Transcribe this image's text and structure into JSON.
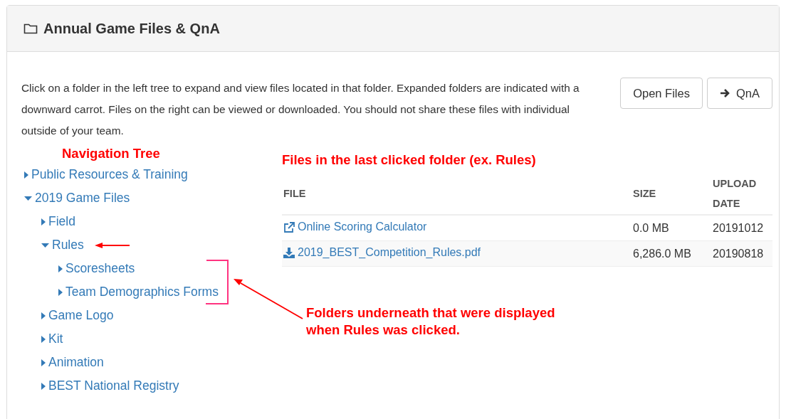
{
  "panel": {
    "title": "Annual Game Files & QnA",
    "intro": "Click on a folder in the left tree to expand and view files located in that folder. Expanded folders are indicated with a downward carrot. Files on the right can be viewed or downloaded. You should not share these files with individual outside of your team.",
    "buttons": [
      {
        "label": "Open Files",
        "kind": "plain"
      },
      {
        "label": "QnA",
        "kind": "arrow"
      }
    ]
  },
  "tree": {
    "annotation": "Navigation Tree",
    "items": [
      {
        "label": "Public Resources & Training",
        "expanded": false
      },
      {
        "label": "2019 Game Files",
        "expanded": true,
        "children": [
          {
            "label": "Field",
            "expanded": false
          },
          {
            "label": "Rules",
            "expanded": true,
            "children": [
              {
                "label": "Scoresheets",
                "expanded": false
              },
              {
                "label": "Team Demographics Forms",
                "expanded": false
              }
            ]
          },
          {
            "label": "Game Logo",
            "expanded": false
          },
          {
            "label": "Kit",
            "expanded": false
          },
          {
            "label": "Animation",
            "expanded": false
          },
          {
            "label": "BEST National Registry",
            "expanded": false
          }
        ]
      }
    ]
  },
  "files": {
    "annotation": "Files in the last clicked folder (ex. Rules)",
    "columns": [
      "FILE",
      "SIZE",
      "UPLOAD DATE"
    ],
    "rows": [
      {
        "kind": "link",
        "name": "Online Scoring Calculator",
        "size": "0.0 MB",
        "date": "20191012"
      },
      {
        "kind": "download",
        "name": "2019_BEST_Competition_Rules.pdf",
        "size": "6,286.0 MB",
        "date": "20190818"
      }
    ]
  },
  "callout": "Folders underneath that were displayed when Rules was clicked."
}
